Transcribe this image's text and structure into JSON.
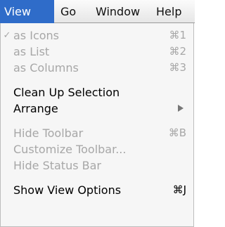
{
  "menubar": {
    "menus": [
      {
        "label": "View",
        "active": true
      },
      {
        "label": "Go"
      },
      {
        "label": "Window"
      },
      {
        "label": "Help"
      }
    ]
  },
  "view_menu": {
    "items": [
      {
        "label": "as Icons",
        "shortcut": "⌘1",
        "checked": true,
        "check_mark": "✓",
        "disabled": true
      },
      {
        "label": "as List",
        "shortcut": "⌘2",
        "disabled": true
      },
      {
        "label": "as Columns",
        "shortcut": "⌘3",
        "disabled": true
      },
      {
        "label": "Clean Up Selection"
      },
      {
        "label": "Arrange",
        "has_submenu": true
      },
      {
        "label": "Hide Toolbar",
        "shortcut": "⌘B",
        "disabled": true
      },
      {
        "label": "Customize Toolbar...",
        "disabled": true
      },
      {
        "label": "Hide Status Bar",
        "disabled": true
      },
      {
        "label": "Show View Options",
        "shortcut": "⌘J"
      }
    ]
  },
  "colors": {
    "menu_highlight": "#2f6cc9",
    "disabled_text": "#a7a7a7",
    "menu_background": "#f6f6f6"
  }
}
